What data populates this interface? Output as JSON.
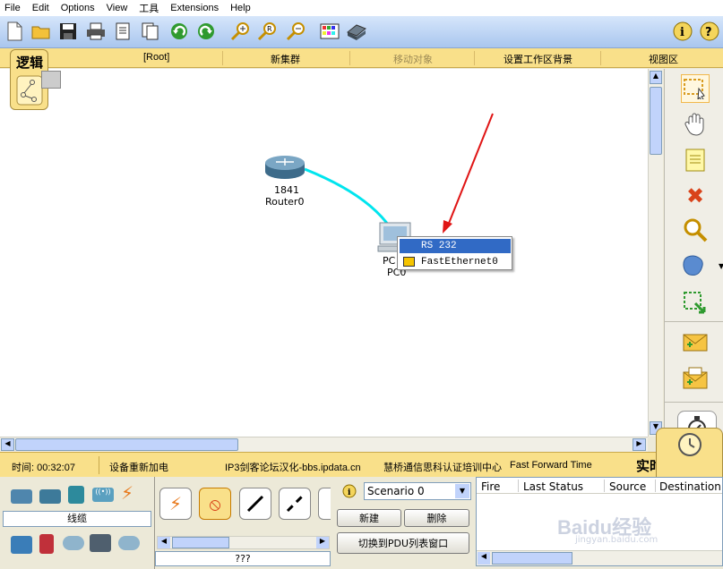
{
  "menu": [
    "File",
    "Edit",
    "Options",
    "View",
    "工具",
    "Extensions",
    "Help"
  ],
  "logical_bar": {
    "tab_label": "逻辑",
    "root": "[Root]",
    "new_cluster": "新集群",
    "move_object": "移动对象",
    "set_background": "设置工作区背景",
    "viewport": "视图区"
  },
  "workspace": {
    "router": {
      "model": "1841",
      "name": "Router0"
    },
    "pc": {
      "name_top": "PC",
      "name_bottom": "PC0"
    },
    "context_menu": {
      "items": [
        {
          "label": "RS 232",
          "selected": true
        },
        {
          "label": "FastEthernet0",
          "selected": false
        }
      ]
    },
    "cable_color": "#00e5ee",
    "arrow_color": "#e01515"
  },
  "status_bar": {
    "time": "时间: 00:32:07",
    "power_cycle": "设备重新加电",
    "watermark1": "IP3剑客论坛汉化-bbs.ipdata.cn",
    "watermark2": "慧桥通信思科认证培训中心",
    "fast_forward": "Fast Forward Time",
    "realtime_tab": "实时"
  },
  "device_panel": {
    "category_label": "线缆",
    "type_label": "???"
  },
  "scenario": {
    "selected": "Scenario 0",
    "new_btn": "新建",
    "delete_btn": "删除",
    "switch_btn": "切换到PDU列表窗口"
  },
  "pdu_table": {
    "columns": [
      "Fire",
      "Last Status",
      "Source",
      "Destination"
    ]
  },
  "watermark": {
    "logo": "Baidu经验",
    "url": "jingyan.baidu.com"
  }
}
